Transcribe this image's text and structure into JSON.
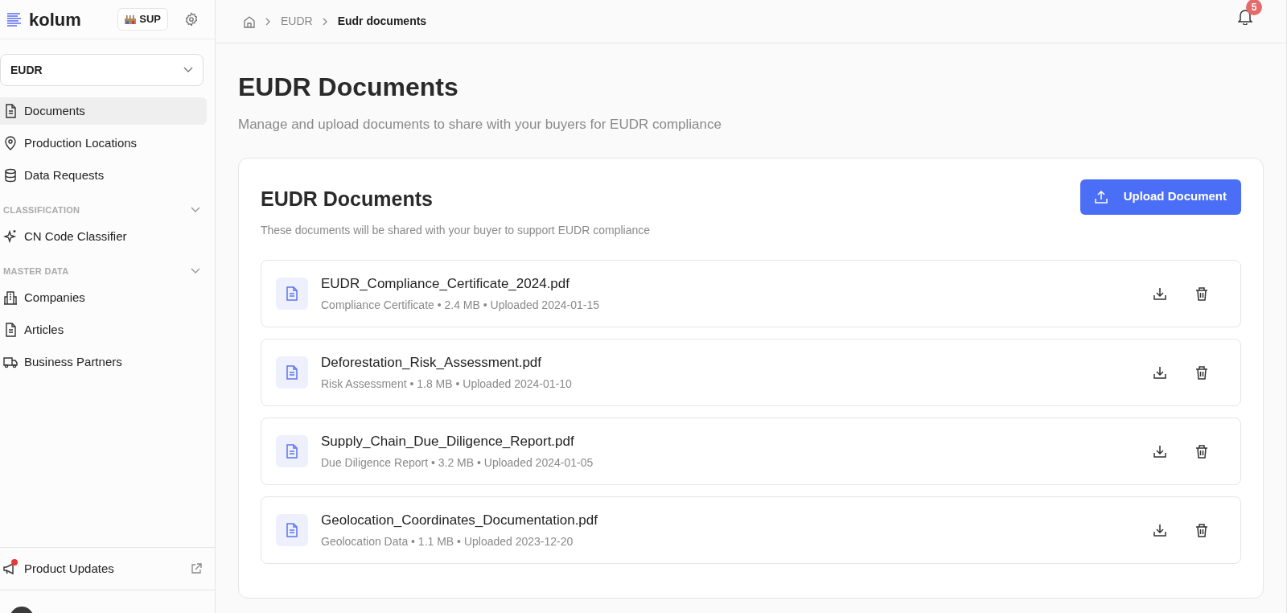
{
  "sidebar": {
    "logo": "kolum",
    "role_badge": "SUP",
    "module_select": {
      "value": "EUDR"
    },
    "items": [
      {
        "label": "Documents",
        "kind": "document",
        "selected": true
      },
      {
        "label": "Production Locations",
        "kind": "pin",
        "selected": false
      },
      {
        "label": "Data Requests",
        "kind": "database",
        "selected": false
      }
    ],
    "sections": [
      {
        "title": "CLASSIFICATION",
        "expanded": true,
        "items": [
          {
            "label": "CN Code Classifier",
            "kind": "sparkle",
            "selected": false
          }
        ]
      },
      {
        "title": "MASTER DATA",
        "expanded": true,
        "items": [
          {
            "label": "Companies",
            "kind": "building",
            "selected": false
          },
          {
            "label": "Articles",
            "kind": "document",
            "selected": false
          },
          {
            "label": "Business Partners",
            "kind": "truck",
            "selected": false
          }
        ]
      }
    ],
    "footer": {
      "label": "Product Updates",
      "has_new": true
    }
  },
  "breadcrumb": [
    "EUDR",
    "Eudr documents"
  ],
  "notifications": {
    "count": "5"
  },
  "page": {
    "title": "EUDR Documents",
    "subtitle": "Manage and upload documents to share with your buyers for EUDR compliance"
  },
  "card": {
    "title": "EUDR Documents",
    "description": "These documents will be shared with your buyer to support EUDR compliance",
    "upload_button": "Upload Document",
    "documents": [
      {
        "name": "EUDR_Compliance_Certificate_2024.pdf",
        "meta": "Compliance Certificate • 2.4 MB • Uploaded 2024-01-15"
      },
      {
        "name": "Deforestation_Risk_Assessment.pdf",
        "meta": "Risk Assessment • 1.8 MB • Uploaded 2024-01-10"
      },
      {
        "name": "Supply_Chain_Due_Diligence_Report.pdf",
        "meta": "Due Diligence Report • 3.2 MB • Uploaded 2024-01-05"
      },
      {
        "name": "Geolocation_Coordinates_Documentation.pdf",
        "meta": "Geolocation Data • 1.1 MB • Uploaded 2023-12-20"
      }
    ]
  }
}
